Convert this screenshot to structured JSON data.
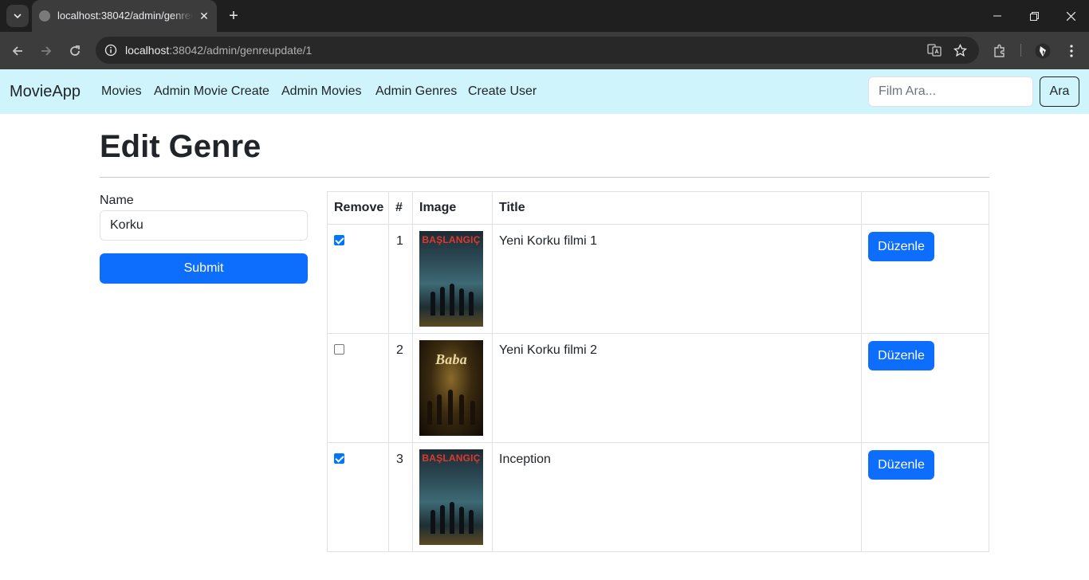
{
  "browser": {
    "tab_title": "localhost:38042/admin/genreupdate/1",
    "url_host": "localhost",
    "url_rest": ":38042/admin/genreupdate/1"
  },
  "navbar": {
    "brand": "MovieApp",
    "links": [
      "Movies",
      "Admin Movie Create",
      "Admin Movies",
      "Admin Genres",
      "Create User"
    ],
    "search_placeholder": "Film Ara...",
    "search_button": "Ara"
  },
  "page": {
    "title": "Edit Genre",
    "name_label": "Name",
    "name_value": "Korku",
    "submit_label": "Submit"
  },
  "table": {
    "headers": [
      "Remove",
      "#",
      "Image",
      "Title",
      ""
    ],
    "rows": [
      {
        "remove": true,
        "index": "1",
        "poster_text": "BAŞLANGIÇ",
        "title": "Yeni Korku filmi 1",
        "action": "Düzenle"
      },
      {
        "remove": false,
        "index": "2",
        "poster_text": "Baba",
        "title": "Yeni Korku filmi 2",
        "action": "Düzenle"
      },
      {
        "remove": true,
        "index": "3",
        "poster_text": "BAŞLANGIÇ",
        "title": "Inception",
        "action": "Düzenle"
      }
    ]
  },
  "colors": {
    "navbar_bg": "#cff4fc",
    "primary": "#0d6efd",
    "checkbox": "#0075ff"
  }
}
